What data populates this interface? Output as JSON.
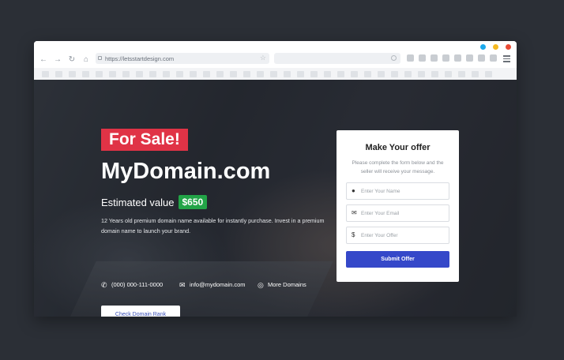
{
  "browser": {
    "url": "https://letsstartdesign.com",
    "dots": [
      "#1ba9ec",
      "#f5b921",
      "#ea4b35"
    ],
    "nav_icons": [
      "back-arrow-icon",
      "forward-arrow-icon",
      "reload-icon",
      "home-icon"
    ]
  },
  "hero": {
    "badge": "For Sale!",
    "domain": "MyDomain.com",
    "estimated_label": "Estimated value",
    "estimated_price": "$650",
    "description": "12 Years old premium domain name available for instantly purchase. Invest in a premium domain name to launch your brand.",
    "contacts": [
      {
        "icon": "phone-icon",
        "text": "(000) 000-111-0000"
      },
      {
        "icon": "mail-icon",
        "text": "info@mydomain.com"
      },
      {
        "icon": "globe-icon",
        "text": "More Domains"
      }
    ],
    "rank_button": "Check Domain Rank"
  },
  "offer_form": {
    "title": "Make Your offer",
    "subtitle": "Please complete the form below and the seller will receive your message.",
    "fields": [
      {
        "icon": "user-icon",
        "placeholder": "Enter Your Name"
      },
      {
        "icon": "mail-icon",
        "placeholder": "Enter Your Email"
      },
      {
        "icon": "dollar-icon",
        "placeholder": "Enter Your Offer"
      }
    ],
    "submit": "Submit Offer"
  },
  "colors": {
    "badge": "#e03346",
    "price": "#22a447",
    "submit": "#3548c9"
  }
}
